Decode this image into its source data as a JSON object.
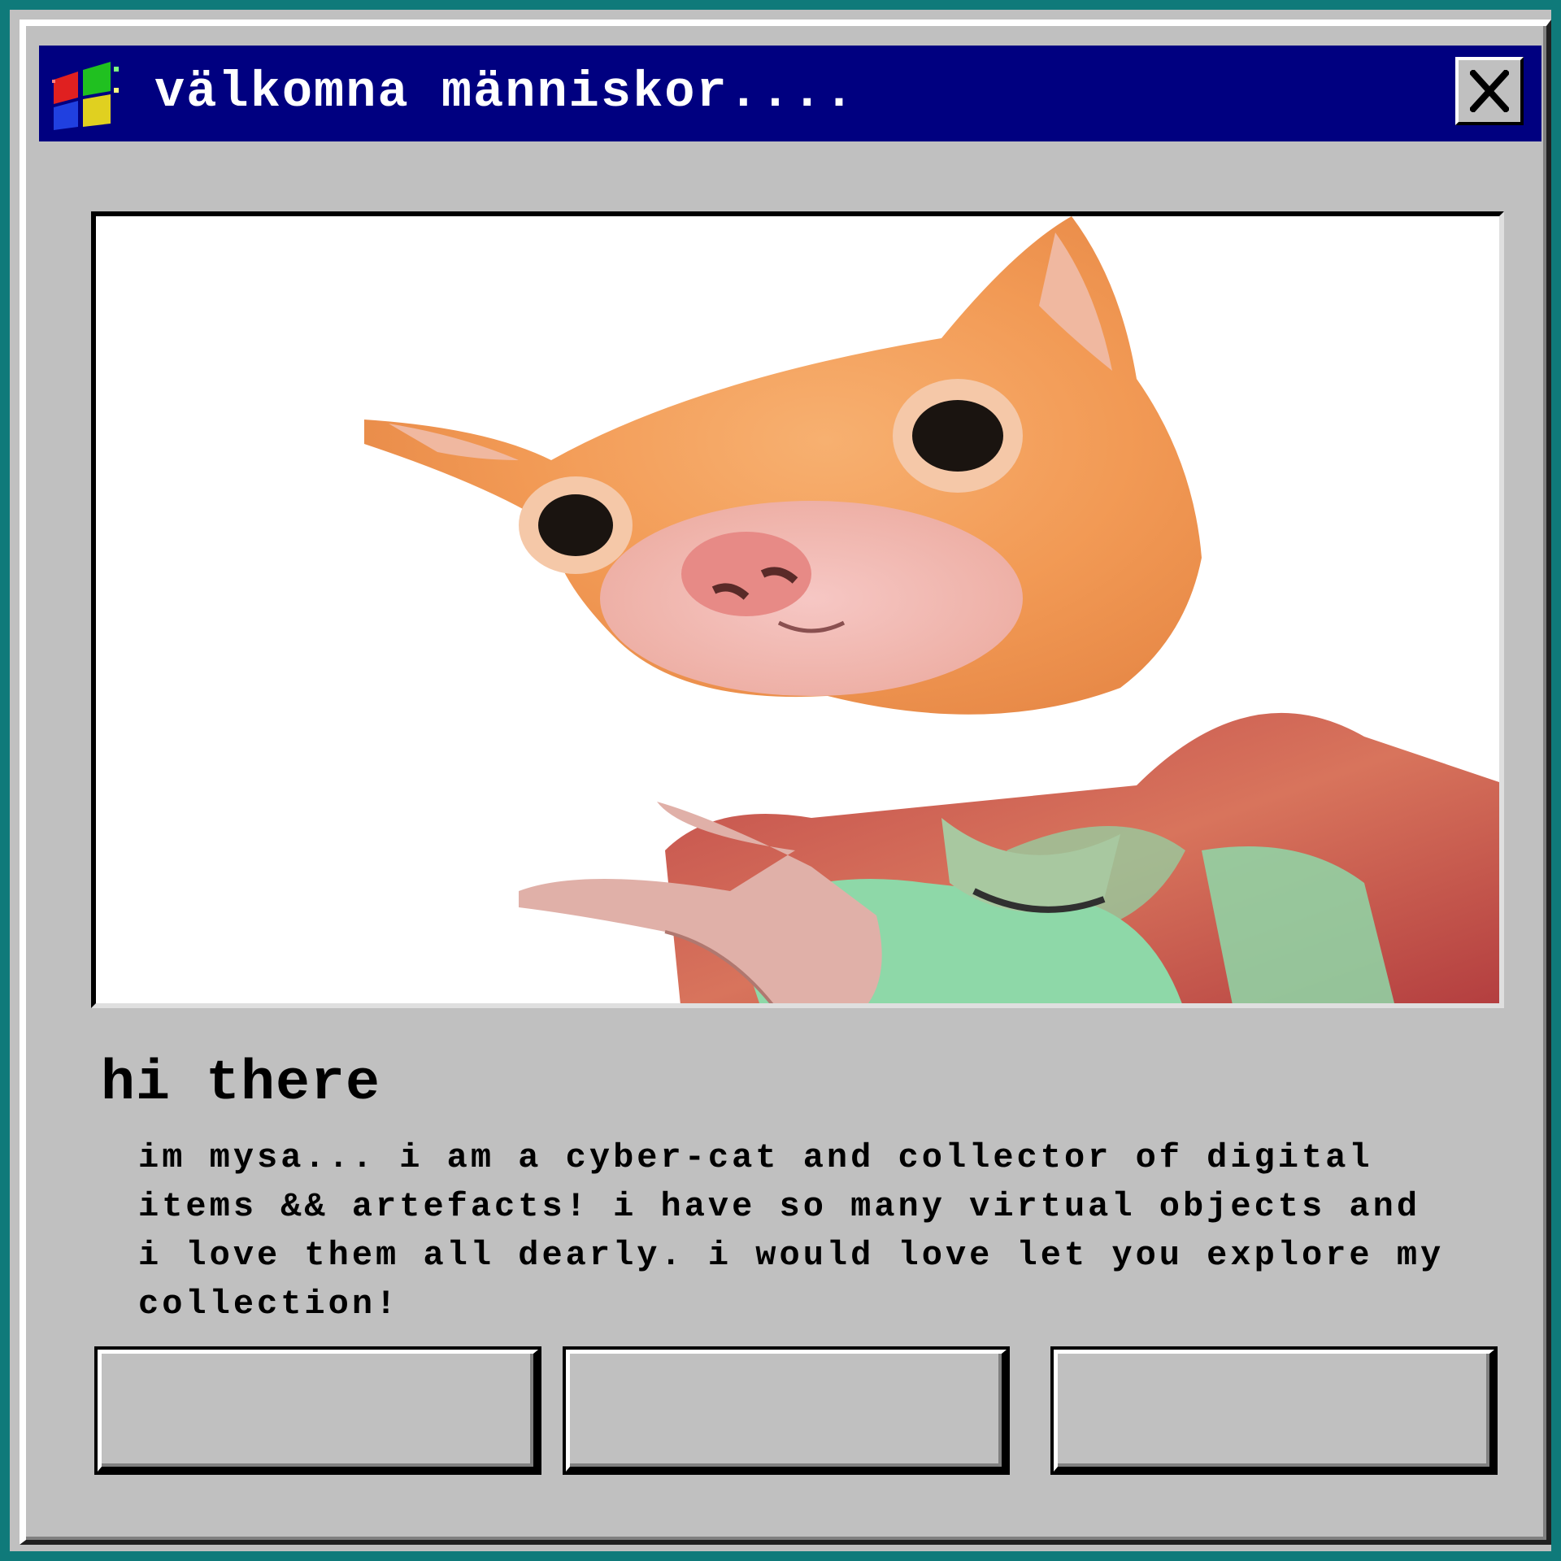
{
  "window": {
    "title": "välkomna människor....",
    "close_glyph": "X",
    "icon": "windows-flag-icon"
  },
  "photo": {
    "icon": "cat-head-selfie-image"
  },
  "content": {
    "heading": "hi there",
    "body": "im mysa... i am a cyber-cat and collector of digital\nitems && artefacts! i have so many virtual objects and\ni love them all dearly. i would love let you explore my\ncollection!"
  },
  "buttons": [
    {
      "label": ""
    },
    {
      "label": ""
    },
    {
      "label": ""
    }
  ],
  "colors": {
    "desktop_teal": "#0f7a7a",
    "titlebar_navy": "#000080",
    "window_gray": "#c0c0c0"
  }
}
